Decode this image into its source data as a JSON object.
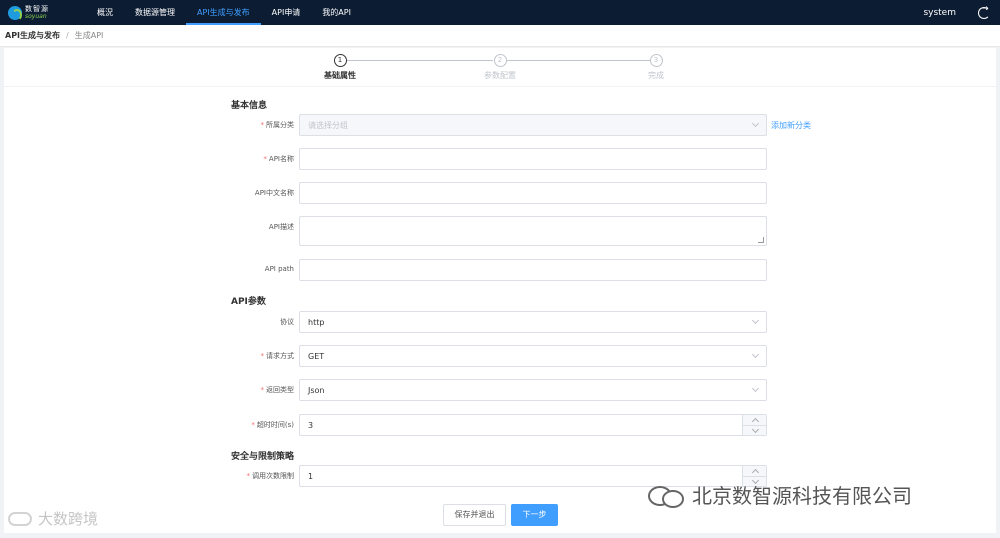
{
  "nav": {
    "logo_cn": "数智源",
    "logo_en": "soyuan",
    "items": [
      {
        "label": "概況"
      },
      {
        "label": "数据源管理"
      },
      {
        "label": "API生成与发布",
        "active": true
      },
      {
        "label": "API申请"
      },
      {
        "label": "我的API"
      }
    ],
    "user": "system",
    "accent": "#409eff",
    "bg": "#0c1c33"
  },
  "breadcrumb": {
    "root": "API生成与发布",
    "separator": "/",
    "current": "生成API"
  },
  "steps": [
    {
      "number": "1",
      "label": "基础属性",
      "active": true
    },
    {
      "number": "2",
      "label": "参数配置",
      "active": false
    },
    {
      "number": "3",
      "label": "完成",
      "active": false
    }
  ],
  "form": {
    "sections": {
      "basic": "基本信息",
      "params": "API参数",
      "security": "安全与限制策略"
    },
    "category": {
      "label": "所属分类",
      "placeholder": "请选择分组",
      "add_link": "添加新分类"
    },
    "api_name": {
      "label": "API名称",
      "value": ""
    },
    "api_cn_name": {
      "label": "API中文名称",
      "value": ""
    },
    "api_desc": {
      "label": "API描述",
      "value": ""
    },
    "api_path": {
      "label": "API path",
      "value": ""
    },
    "protocol": {
      "label": "协议",
      "value": "http"
    },
    "method": {
      "label": "请求方式",
      "value": "GET"
    },
    "return_type": {
      "label": "返回类型",
      "value": "Json"
    },
    "timeout": {
      "label": "超时时间(s)",
      "value": "3"
    },
    "call_limit": {
      "label": "调用次数限制",
      "value": "1"
    }
  },
  "buttons": {
    "save_exit": "保存并退出",
    "next": "下一步"
  },
  "watermarks": {
    "left": "大数跨境",
    "right": "北京数智源科技有限公司"
  }
}
